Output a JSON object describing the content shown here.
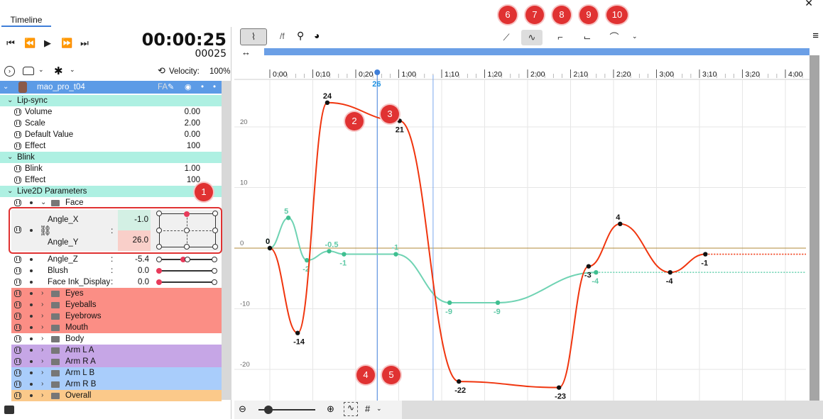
{
  "window": {
    "tab": "Timeline",
    "close_glyph": "✕"
  },
  "transport": {
    "timecode": "00:00:25",
    "frame": "00025",
    "velocity_label": "Velocity:",
    "velocity_value": "100%"
  },
  "layer": {
    "name": "mao_pro_t04",
    "fa": "FA"
  },
  "rows": {
    "lipsync": "Lip-sync",
    "volume": "Volume",
    "volume_v": "0.00",
    "scale": "Scale",
    "scale_v": "2.00",
    "default": "Default Value",
    "default_v": "0.00",
    "effect1": "Effect",
    "effect1_v": "100",
    "blink_grp": "Blink",
    "blink": "Blink",
    "blink_v": "1.00",
    "effect2": "Effect",
    "effect2_v": "100",
    "live2d": "Live2D Parameters",
    "face": "Face",
    "angle_x": "Angle_X",
    "angle_x_v": "-1.0",
    "angle_y": "Angle_Y",
    "angle_y_v": "26.0",
    "angle_z": "Angle_Z",
    "angle_z_v": "-5.4",
    "blush": "Blush",
    "blush_v": "0.0",
    "ink": "Face Ink_Display",
    "ink_v": "0.0",
    "colon": ":",
    "eyes": "Eyes",
    "eyeballs": "Eyeballs",
    "eyebrows": "Eyebrows",
    "mouth": "Mouth",
    "body": "Body",
    "arm_la": "Arm L A",
    "arm_ra": "Arm R A",
    "arm_lb": "Arm L B",
    "arm_rb": "Arm R B",
    "overall": "Overall"
  },
  "graph_toolbar": {
    "f_label": "/f"
  },
  "badges": {
    "b1": "1",
    "b2": "2",
    "b3": "3",
    "b4": "4",
    "b5": "5",
    "b6": "6",
    "b7": "7",
    "b8": "8",
    "b9": "9",
    "b10": "10"
  },
  "colors": {
    "red_curve": "#f0350e",
    "green_curve": "#6fd3b3",
    "accent": "#3f7fd9",
    "badge": "#e03232"
  },
  "ruler": {
    "ticks": [
      "0:00",
      "0:10",
      "0:20",
      "1:00",
      "1:10",
      "1:20",
      "2:00",
      "2:10",
      "2:20",
      "3:00",
      "3:10",
      "3:20",
      "4:00"
    ],
    "playhead": "26"
  },
  "chart_data": {
    "type": "line",
    "title": "",
    "xlabel": "",
    "ylabel": "",
    "y_ticks": [
      "20",
      "10",
      "0",
      "-10",
      "-20"
    ],
    "ylim": [
      -24,
      28
    ],
    "x": [
      "0:00",
      "0:10",
      "0:20",
      "1:00",
      "1:10",
      "1:20",
      "2:00",
      "2:10",
      "2:20",
      "3:00",
      "3:10",
      "3:20",
      "4:00"
    ],
    "series": [
      {
        "color": "#f0350e",
        "points": [
          {
            "t": 0,
            "v": 0,
            "label": "0"
          },
          {
            "t": 1.5,
            "v": -14,
            "label": "-14"
          },
          {
            "t": 3.1,
            "v": 24,
            "label": "24"
          },
          {
            "t": 7.0,
            "v": 21,
            "label": "21"
          },
          {
            "t": 10.2,
            "v": -22,
            "label": "-22"
          },
          {
            "t": 15.6,
            "v": -23,
            "label": "-23"
          },
          {
            "t": 17.2,
            "v": -3,
            "label": "-3"
          },
          {
            "t": 18.9,
            "v": 4,
            "label": "4"
          },
          {
            "t": 21.6,
            "v": -4,
            "label": "-4"
          },
          {
            "t": 23.5,
            "v": -1,
            "label": "-1"
          }
        ]
      },
      {
        "color": "#6fd3b3",
        "points": [
          {
            "t": 0,
            "v": 0,
            "label": "0"
          },
          {
            "t": 1,
            "v": 5,
            "label": "5"
          },
          {
            "t": 2,
            "v": -2,
            "label": "-2"
          },
          {
            "t": 3.2,
            "v": -0.5,
            "label": "-0.5"
          },
          {
            "t": 4,
            "v": -1,
            "label": "-1"
          },
          {
            "t": 6.8,
            "v": -1,
            "label": "-1"
          },
          {
            "t": 9.7,
            "v": -9,
            "label": "-9"
          },
          {
            "t": 12.3,
            "v": -9,
            "label": "-9"
          },
          {
            "t": 17.6,
            "v": -4,
            "label": "-4"
          }
        ]
      }
    ]
  }
}
